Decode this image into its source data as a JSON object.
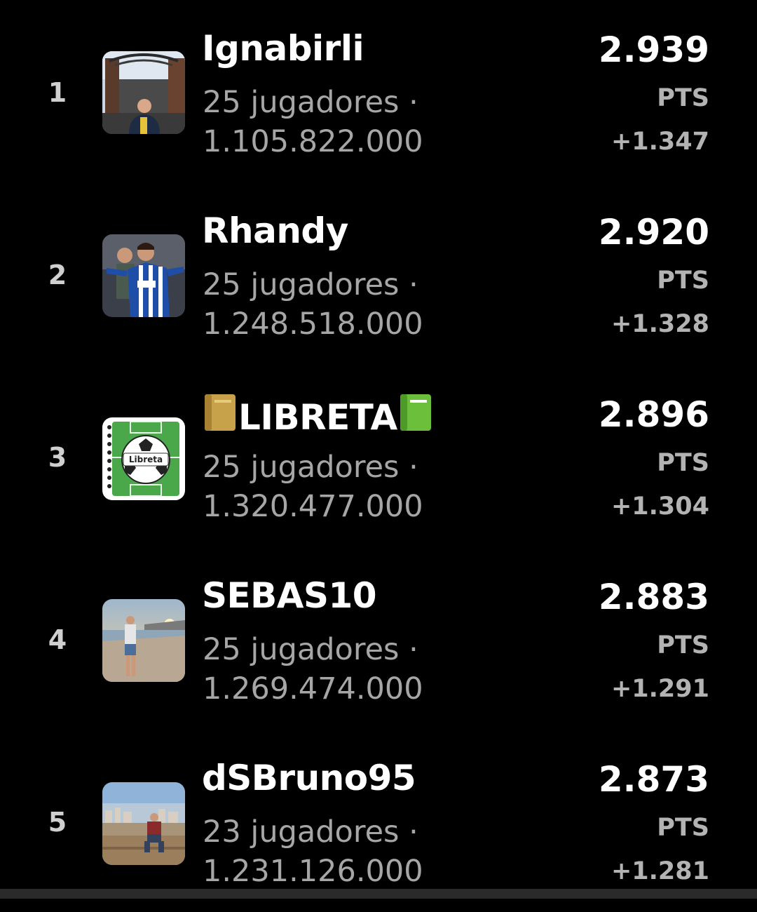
{
  "ranking": [
    {
      "rank": "1",
      "name": "Ignabirli",
      "players": "25 jugadores ·",
      "value": "1.105.822.000",
      "points": "2.939",
      "points_label": "PTS",
      "delta": "+1.347",
      "avatar_icon": "stadium-gate-photo"
    },
    {
      "rank": "2",
      "name": "Rhandy",
      "players": "25 jugadores ·",
      "value": "1.248.518.000",
      "points": "2.920",
      "points_label": "PTS",
      "delta": "+1.328",
      "avatar_icon": "football-player-photo"
    },
    {
      "rank": "3",
      "name_prefix_emoji": "notebook-yellow-icon",
      "name": "LIBRETA",
      "name_suffix_emoji": "notebook-green-icon",
      "players": "25 jugadores ·",
      "value": "1.320.477.000",
      "points": "2.896",
      "points_label": "PTS",
      "delta": "+1.304",
      "avatar_icon": "libreta-ball-logo",
      "avatar_text": "Libreta"
    },
    {
      "rank": "4",
      "name": "SEBAS10",
      "players": "25 jugadores ·",
      "value": "1.269.474.000",
      "points": "2.883",
      "points_label": "PTS",
      "delta": "+1.291",
      "avatar_icon": "beach-sunset-photo"
    },
    {
      "rank": "5",
      "name": "dSBruno95",
      "players": "23 jugadores ·",
      "value": "1.231.126.000",
      "points": "2.873",
      "points_label": "PTS",
      "delta": "+1.281",
      "avatar_icon": "city-view-photo"
    }
  ],
  "colors": {
    "background": "#000000",
    "name": "#ffffff",
    "secondary": "#a6a6a6",
    "label": "#b3b3b3"
  }
}
